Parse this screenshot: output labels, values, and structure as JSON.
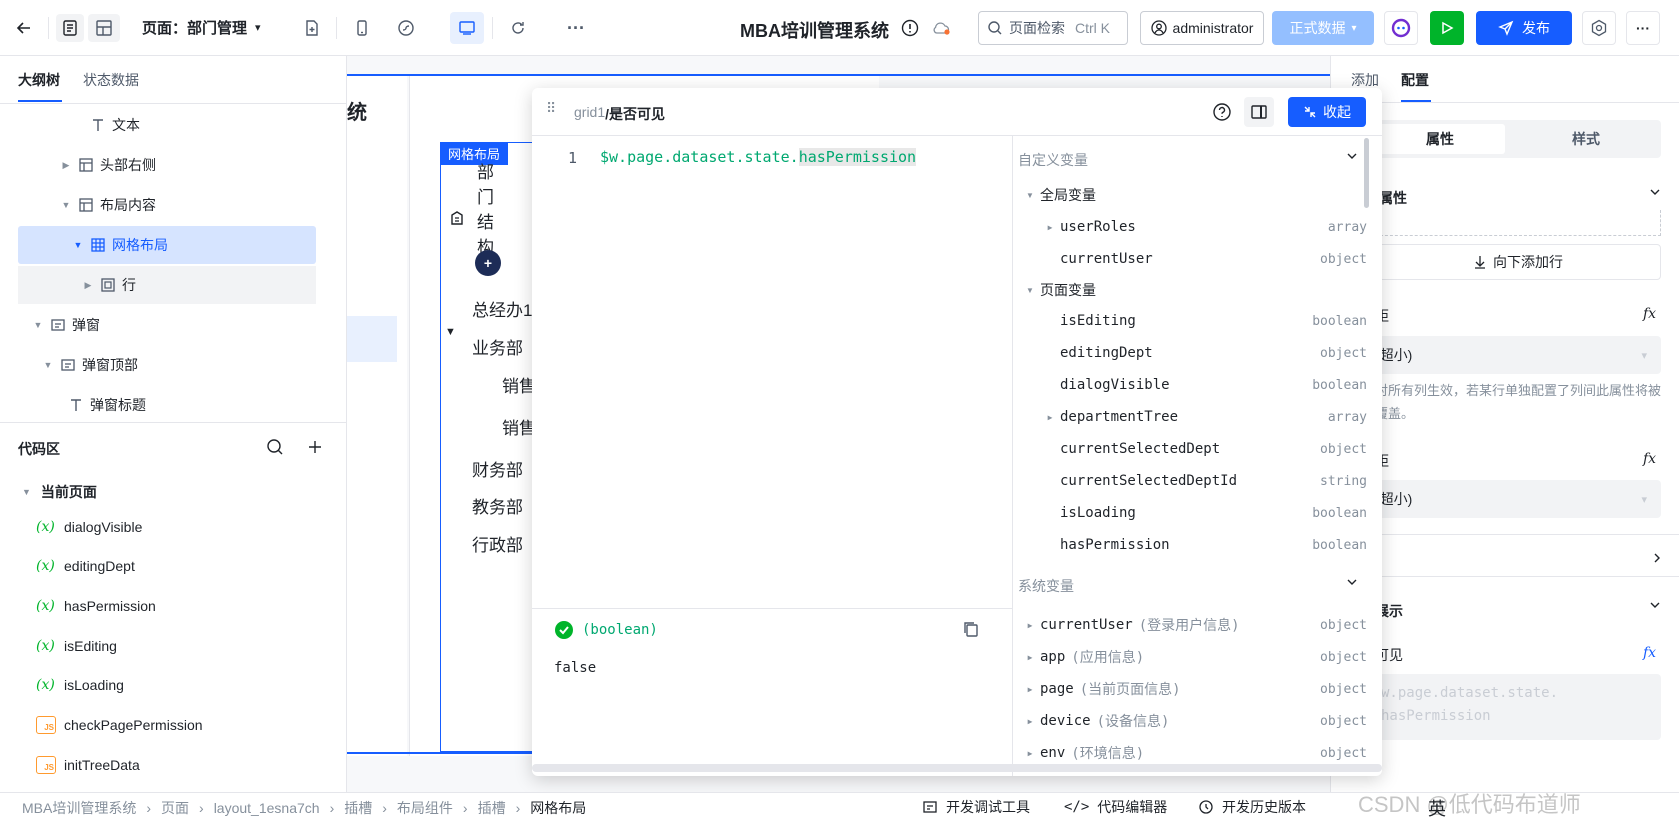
{
  "topbar": {
    "page_label": "页面：部门管理",
    "app_title": "MBA培训管理系统",
    "search_placeholder": "页面检索",
    "search_shortcut": "Ctrl K",
    "user": "administrator",
    "env_label": "正式数据",
    "publish_label": "发布",
    "accent": "#165dff"
  },
  "left": {
    "tabs": [
      "大纲树",
      "状态数据"
    ],
    "tree": [
      {
        "label": "文本"
      },
      {
        "label": "头部右侧"
      },
      {
        "label": "布局内容"
      },
      {
        "label": "网格布局"
      },
      {
        "label": "行"
      },
      {
        "label": "弹窗"
      },
      {
        "label": "弹窗顶部"
      },
      {
        "label": "弹窗标题"
      }
    ],
    "code_title": "代码区",
    "current_page": "当前页面",
    "vars": [
      "dialogVisible",
      "editingDept",
      "hasPermission",
      "isEditing",
      "isLoading"
    ],
    "funcs": [
      "checkPagePermission",
      "initTreeData"
    ]
  },
  "canvas": {
    "grid_tag": "网格布局",
    "org_title": "部门结构",
    "items": [
      "总经办1",
      "业务部",
      "销售",
      "销售",
      "财务部",
      "教务部",
      "行政部"
    ]
  },
  "popup": {
    "path_prefix": "grid1",
    "path_name": "/是否可见",
    "collapse_label": "收起",
    "line_no": "1",
    "code_main": "$w.page.dataset.state.",
    "code_highlight": "hasPermission",
    "result_type": "(boolean)",
    "result_value": "false",
    "custom_vars_title": "自定义变量",
    "global_vars_title": "全局变量",
    "page_vars_title": "页面变量",
    "system_vars_title": "系统变量",
    "global_vars": [
      {
        "name": "userRoles",
        "type": "array"
      },
      {
        "name": "currentUser",
        "type": "object"
      }
    ],
    "page_vars": [
      {
        "name": "isEditing",
        "type": "boolean"
      },
      {
        "name": "editingDept",
        "type": "object"
      },
      {
        "name": "dialogVisible",
        "type": "boolean"
      },
      {
        "name": "departmentTree",
        "type": "array"
      },
      {
        "name": "currentSelectedDept",
        "type": "object"
      },
      {
        "name": "currentSelectedDeptId",
        "type": "string"
      },
      {
        "name": "isLoading",
        "type": "boolean"
      },
      {
        "name": "hasPermission",
        "type": "boolean"
      }
    ],
    "system_vars": [
      {
        "name": "currentUser",
        "desc": "(登录用户信息)",
        "type": "object"
      },
      {
        "name": "app",
        "desc": "(应用信息)",
        "type": "object"
      },
      {
        "name": "page",
        "desc": "(当前页面信息)",
        "type": "object"
      },
      {
        "name": "device",
        "desc": "(设备信息)",
        "type": "object"
      },
      {
        "name": "env",
        "desc": "(环境信息)",
        "type": "object"
      }
    ]
  },
  "right": {
    "tabs": [
      "添加",
      "配置"
    ],
    "seg": [
      "属性",
      "样式"
    ],
    "section_attr": "属性",
    "add_row": "向下添加行",
    "gap1_label": "距",
    "gap1_value": "(超小)",
    "hint": "对所有列生效，若某行单独配置了列间此属性将被覆盖。",
    "gap2_label": "距",
    "gap2_value": "(超小)",
    "section_show": "展示",
    "visible_label": "可见",
    "expr_line1": "w.page.dataset.state.",
    "expr_line2": "hasPermission"
  },
  "bottom": {
    "crumbs": [
      "MBA培训管理系统",
      "页面",
      "layout_1esna7ch",
      "插槽",
      "布局组件",
      "插槽",
      "网格布局"
    ],
    "tools": [
      "开发调试工具",
      "代码编辑器",
      "开发历史版本"
    ],
    "watermark": "CSDN @低代码布道师",
    "ime": "英"
  }
}
